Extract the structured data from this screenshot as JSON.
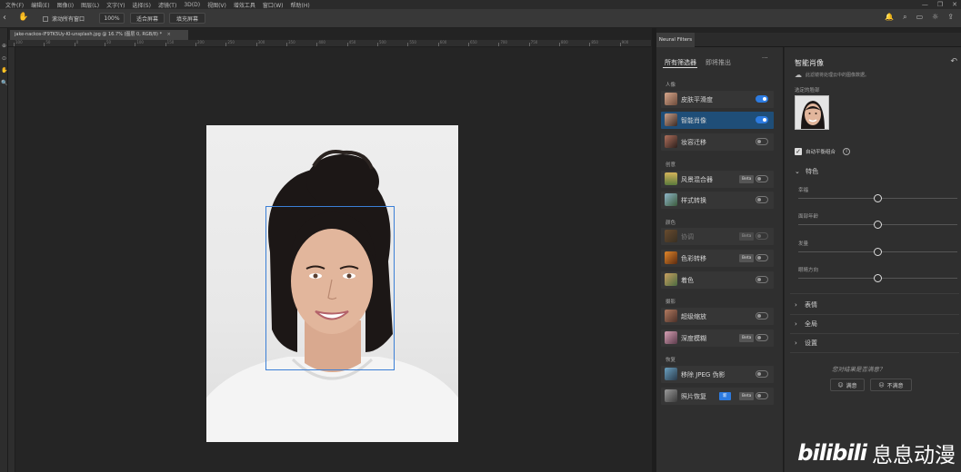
{
  "menubar": {
    "items": [
      "文件(F)",
      "编辑(E)",
      "图像(I)",
      "图层(L)",
      "文字(Y)",
      "选择(S)",
      "滤镜(T)",
      "3D(D)",
      "视图(V)",
      "增效工具",
      "窗口(W)",
      "帮助(H)"
    ]
  },
  "optbar": {
    "scroll_all_label": "滚动所有窗口",
    "zoom_value": "100%",
    "fit_screen_label": "适合屏幕",
    "fill_screen_label": "填充屏幕"
  },
  "document": {
    "tab_title": "jake-nackos-IF9TK5Uy-KI-unsplash.jpg @ 16.7% (图层 0, RGB/8) *",
    "ruler_ticks": [
      "100",
      "50",
      "0",
      "50",
      "100",
      "150",
      "200",
      "250",
      "300",
      "350",
      "400",
      "450",
      "500",
      "550",
      "600",
      "650",
      "700",
      "750",
      "800",
      "850",
      "900"
    ]
  },
  "neural_filters": {
    "panel_tab": "Neural Filters",
    "list_tabs": {
      "all": "所有筛选器",
      "wait_list": "即将推出"
    },
    "more": "···",
    "sections": {
      "portrait": "人像",
      "creative": "创意",
      "color": "颜色",
      "photography": "摄影",
      "restore": "恢复"
    },
    "filters": [
      {
        "label": "皮肤平滑度",
        "on": true
      },
      {
        "label": "智能肖像",
        "on": true,
        "selected": true
      },
      {
        "label": "妆容迁移",
        "on": false
      },
      {
        "label": "风景混合器",
        "beta": "Beta",
        "on": false
      },
      {
        "label": "样式转换",
        "on": false
      },
      {
        "label": "协调",
        "beta": "Beta",
        "on": false,
        "disabled": true
      },
      {
        "label": "色彩转移",
        "beta": "Beta",
        "on": false
      },
      {
        "label": "着色",
        "on": false
      },
      {
        "label": "超级缩放",
        "on": false
      },
      {
        "label": "深度模糊",
        "beta": "Beta",
        "on": false
      },
      {
        "label": "移除 JPEG 伪影",
        "on": false
      },
      {
        "label": "照片恢复",
        "new": "新",
        "beta": "Beta",
        "on": false
      }
    ],
    "detail": {
      "title": "智能肖像",
      "cloud_note": "此滤镜将处理云中的图像数据。",
      "selected_face_label": "选定的脸部",
      "auto_balance_label": "自动平衡组合",
      "featured_section": "特色",
      "sliders": [
        {
          "label": "幸福",
          "value": 0.5
        },
        {
          "label": "面部年龄",
          "value": 0.5
        },
        {
          "label": "发量",
          "value": 0.5
        },
        {
          "label": "眼睛方向",
          "value": 0.5
        }
      ],
      "expression_section": "表情",
      "global_section": "全局",
      "settings_section": "设置",
      "feedback_question": "您对结果是否满意？",
      "satisfied": "满意",
      "not_satisfied": "不满意"
    }
  },
  "watermark": {
    "logo": "bilibili",
    "text": "息息动漫"
  }
}
